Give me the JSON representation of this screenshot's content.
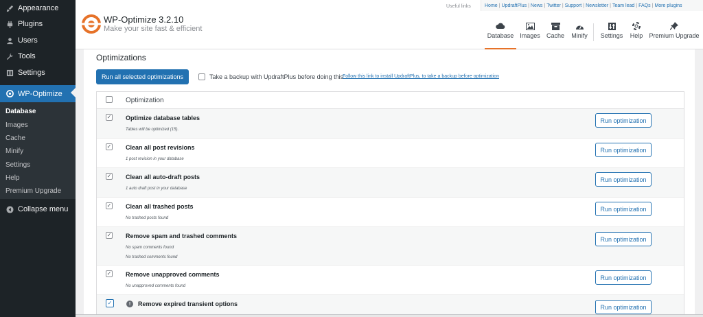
{
  "sidebar": {
    "items": [
      {
        "label": "Appearance",
        "icon": "paintbrush-icon"
      },
      {
        "label": "Plugins",
        "icon": "plugin-icon"
      },
      {
        "label": "Users",
        "icon": "users-icon"
      },
      {
        "label": "Tools",
        "icon": "wrench-icon"
      },
      {
        "label": "Settings",
        "icon": "settings-icon"
      },
      {
        "label": "WP-Optimize",
        "icon": "wp-optimize-icon"
      }
    ],
    "submenu": [
      "Database",
      "Images",
      "Cache",
      "Minify",
      "Settings",
      "Help",
      "Premium Upgrade"
    ],
    "collapse_label": "Collapse menu"
  },
  "header": {
    "title": "WP-Optimize 3.2.10",
    "subtitle": "Make your site fast & efficient",
    "useful_links_label": "Useful links",
    "links": [
      "Home",
      "UpdraftPlus",
      "News",
      "Twitter",
      "Support",
      "Newsletter",
      "Team lead",
      "FAQs",
      "More plugins"
    ],
    "tabs": [
      "Database",
      "Images",
      "Cache",
      "Minify",
      "Settings",
      "Help",
      "Premium Upgrade"
    ],
    "accent_color": "#e67229"
  },
  "main": {
    "section_title": "Optimizations",
    "run_all_label": "Run all selected optimizations",
    "backup_text": "Take a backup with UpdraftPlus before doing this",
    "backup_link": "Follow this link to install UpdraftPlus, to take a backup before optimization",
    "table_header": "Optimization",
    "run_label": "Run optimization",
    "rows": [
      {
        "title": "Optimize database tables",
        "info": [
          "Tables will be optimized (15)."
        ]
      },
      {
        "title": "Clean all post revisions",
        "info": [
          "1 post revision in your database"
        ]
      },
      {
        "title": "Clean all auto-draft posts",
        "info": [
          "1 auto draft post in your database"
        ]
      },
      {
        "title": "Clean all trashed posts",
        "info": [
          "No trashed posts found"
        ]
      },
      {
        "title": "Remove spam and trashed comments",
        "info": [
          "No spam comments found",
          "No trashed comments found"
        ]
      },
      {
        "title": "Remove unapproved comments",
        "info": [
          "No unapproved comments found"
        ]
      },
      {
        "title": "Remove expired transient options",
        "info": []
      }
    ]
  }
}
